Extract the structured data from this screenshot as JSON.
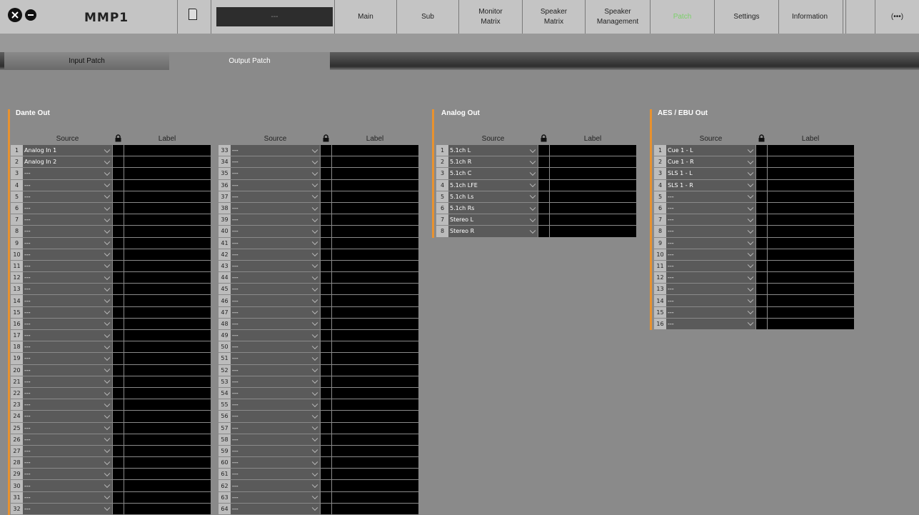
{
  "app": {
    "title": "MMP1",
    "scene_display": "---"
  },
  "nav": [
    {
      "label": "Main",
      "active": false
    },
    {
      "label": "Sub",
      "active": false
    },
    {
      "label": "Monitor\nMatrix",
      "active": false
    },
    {
      "label": "Speaker\nMatrix",
      "active": false
    },
    {
      "label": "Speaker\nManagement",
      "active": false
    },
    {
      "label": "Patch",
      "active": true
    },
    {
      "label": "Settings",
      "active": false
    },
    {
      "label": "Information",
      "active": false
    }
  ],
  "more_label": "(•••)",
  "colors": {
    "accent": "#e8922f",
    "active_tab": "#7cd06a",
    "topbar": "#c4c4c4",
    "background": "#8a8a8a"
  },
  "subtabs": [
    {
      "label": "Input Patch",
      "active": false
    },
    {
      "label": "Output Patch",
      "active": true
    }
  ],
  "columns": {
    "source": "Source",
    "label": "Label"
  },
  "sections": [
    {
      "id": "dante",
      "title": "Dante Out",
      "blocks": [
        [
          "Analog In  1",
          "Analog In  2",
          "---",
          "---",
          "---",
          "---",
          "---",
          "---",
          "---",
          "---",
          "---",
          "---",
          "---",
          "---",
          "---",
          "---",
          "---",
          "---",
          "---",
          "---",
          "---",
          "---",
          "---",
          "---",
          "---",
          "---",
          "---",
          "---",
          "---",
          "---",
          "---",
          "---"
        ],
        [
          "---",
          "---",
          "---",
          "---",
          "---",
          "---",
          "---",
          "---",
          "---",
          "---",
          "---",
          "---",
          "---",
          "---",
          "---",
          "---",
          "---",
          "---",
          "---",
          "---",
          "---",
          "---",
          "---",
          "---",
          "---",
          "---",
          "---",
          "---",
          "---",
          "---",
          "---",
          "---"
        ]
      ]
    },
    {
      "id": "analog",
      "title": "Analog Out",
      "blocks": [
        [
          "5.1ch L",
          "5.1ch R",
          "5.1ch C",
          "5.1ch LFE",
          "5.1ch Ls",
          "5.1ch Rs",
          "Stereo L",
          "Stereo R"
        ]
      ]
    },
    {
      "id": "aes",
      "title": "AES / EBU Out",
      "blocks": [
        [
          "Cue 1 - L",
          "Cue 1 - R",
          "SLS 1 - L",
          "SLS 1 - R",
          "---",
          "---",
          "---",
          "---",
          "---",
          "---",
          "---",
          "---",
          "---",
          "---",
          "---",
          "---"
        ]
      ]
    }
  ]
}
